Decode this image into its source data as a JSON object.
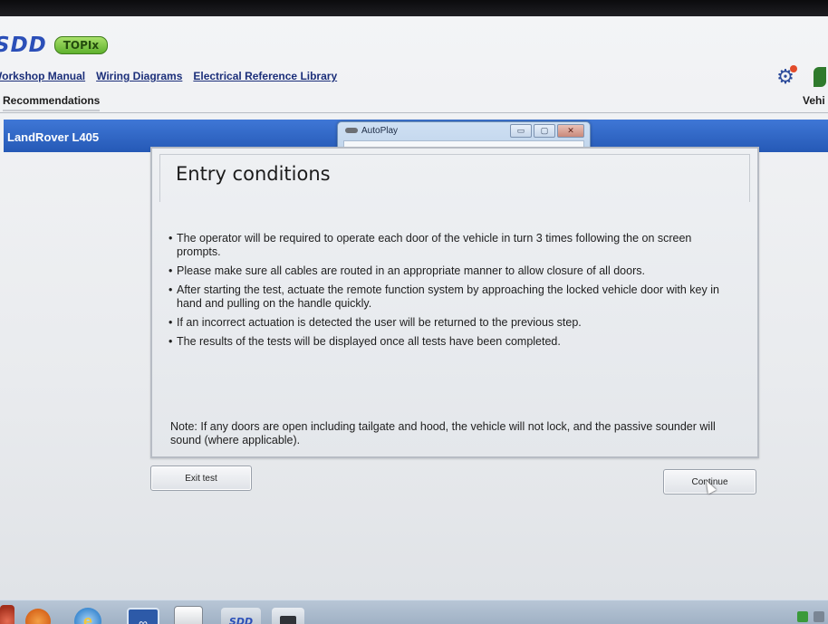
{
  "header": {
    "brand": "SDD",
    "badge": "TOPIx",
    "nav_links": [
      {
        "label": "Workshop Manual"
      },
      {
        "label": "Wiring Diagrams"
      },
      {
        "label": "Electrical Reference Library"
      }
    ],
    "tab": "Recommendations",
    "right_label": "Vehi"
  },
  "vehicle": {
    "name": "LandRover L405"
  },
  "autoplay": {
    "title": "AutoPlay",
    "minimize_glyph": "▭",
    "maximize_glyph": "▢",
    "close_glyph": "✕"
  },
  "dialog": {
    "title": "Entry conditions",
    "bullets": [
      "The operator will be required to operate each door of the vehicle in turn 3 times following the on screen prompts.",
      "Please make sure all cables are routed in an appropriate manner to allow closure of all doors.",
      "After starting the test, actuate the remote function system by approaching the locked vehicle door with key in hand and pulling on the handle quickly.",
      "If an incorrect actuation is detected the user will be returned to the previous step.",
      "The results of the tests will be displayed once all tests have been completed."
    ],
    "note": "Note: If any doors are open including tailgate and hood, the vehicle will not lock, and the passive sounder will sound (where applicable)."
  },
  "buttons": {
    "exit": "Exit test",
    "continue": "Continue"
  },
  "taskbar": {
    "sdd_label": "SDD",
    "ie_glyph": "e",
    "link_glyph": "∞"
  },
  "icons": {
    "gear": "gear-icon",
    "leaf": "leaf-icon",
    "cursor": "mouse-cursor-icon"
  },
  "colors": {
    "vehicle_bar": "#2f66c4",
    "brand_blue": "#2b4fb8",
    "topix_green": "#5fb12d",
    "nav_link": "#1c2f7a"
  }
}
